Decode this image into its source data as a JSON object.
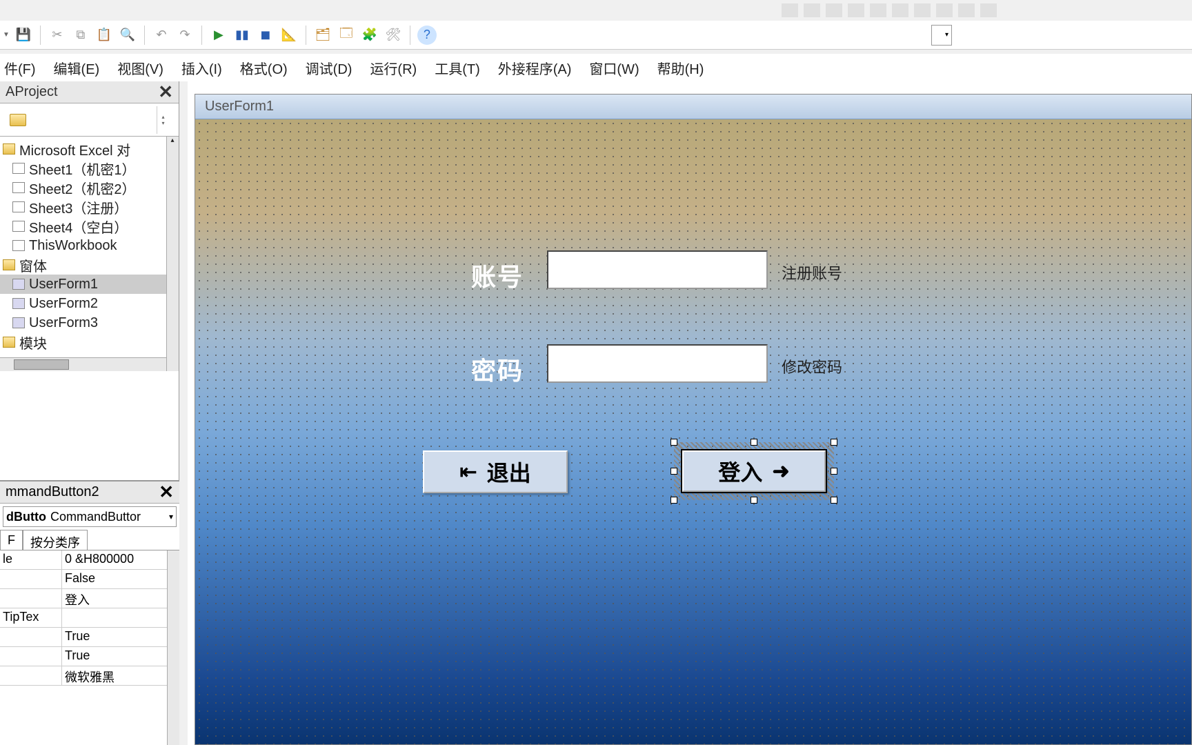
{
  "menus": {
    "file": "件(F)",
    "edit": "编辑(E)",
    "view": "视图(V)",
    "insert": "插入(I)",
    "format": "格式(O)",
    "debug": "调试(D)",
    "run": "运行(R)",
    "tools": "工具(T)",
    "addins": "外接程序(A)",
    "window": "窗口(W)",
    "help": "帮助(H)"
  },
  "project_panel": {
    "title": "AProject",
    "group_excel": "Microsoft Excel 对",
    "sheets": [
      "Sheet1（机密1）",
      "Sheet2（机密2）",
      "Sheet3（注册）",
      "Sheet4（空白）",
      "ThisWorkbook"
    ],
    "forms_folder": "窗体",
    "forms": [
      "UserForm1",
      "UserForm2",
      "UserForm3"
    ],
    "modules_folder": "模块"
  },
  "properties_panel": {
    "title": "mmandButton2",
    "type_bold": "dButto",
    "type_rest": "CommandButtor",
    "tab_alpha": "F",
    "tab_category": "按分类序",
    "rows": [
      {
        "k": "le",
        "v": "0 &H800000"
      },
      {
        "k": "",
        "v": "False"
      },
      {
        "k": "",
        "v": "登入"
      },
      {
        "k": "TipTex",
        "v": ""
      },
      {
        "k": "",
        "v": "True"
      },
      {
        "k": "",
        "v": "True"
      },
      {
        "k": "",
        "v": "微软雅黑"
      }
    ]
  },
  "form": {
    "title": "UserForm1",
    "label_account": "账号",
    "label_password": "密码",
    "link_register": "注册账号",
    "link_changepw": "修改密码",
    "btn_exit": "退出",
    "btn_login": "登入"
  }
}
